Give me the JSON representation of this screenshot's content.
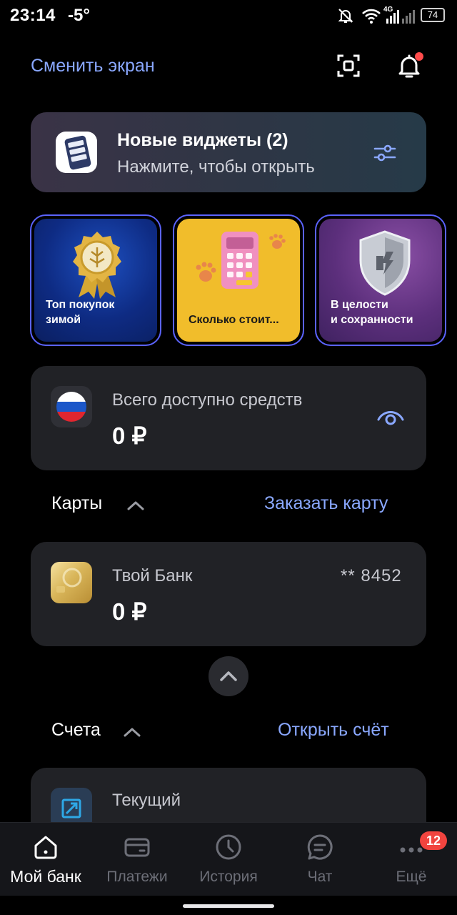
{
  "status_bar": {
    "time": "23:14",
    "temperature": "-5°",
    "battery": "74",
    "network": "4G"
  },
  "header": {
    "switch_screen": "Сменить экран",
    "notification_dot_color": "#ff4b4b"
  },
  "widgets_banner": {
    "title": "Новые виджеты (2)",
    "subtitle": "Нажмите, чтобы открыть"
  },
  "stories": [
    {
      "text": "Топ покупок\nзимой",
      "icon": "award-medal-icon"
    },
    {
      "text": "Сколько стоит...",
      "icon": "calculator-icon"
    },
    {
      "text": "В целости\nи сохранности",
      "icon": "shield-icon"
    }
  ],
  "balance": {
    "label": "Всего доступно средств",
    "value": "0 ₽"
  },
  "cards_section": {
    "title": "Карты",
    "action": "Заказать карту"
  },
  "card": {
    "name": "Твой Банк",
    "mask": "** 8452",
    "balance": "0 ₽"
  },
  "accounts_section": {
    "title": "Счета",
    "action": "Открыть счёт"
  },
  "account": {
    "name": "Текущий"
  },
  "bottom_nav": {
    "items": [
      {
        "label": "Мой банк",
        "icon": "home-icon",
        "active": true
      },
      {
        "label": "Платежи",
        "icon": "wallet-icon",
        "active": false
      },
      {
        "label": "История",
        "icon": "clock-icon",
        "active": false
      },
      {
        "label": "Чат",
        "icon": "chat-icon",
        "active": false
      },
      {
        "label": "Ещё",
        "icon": "more-icon",
        "active": false
      }
    ],
    "more_badge": "12"
  },
  "colors": {
    "accent": "#8aa8ff",
    "story_border": "#5b63ff",
    "badge": "#f1443f"
  }
}
